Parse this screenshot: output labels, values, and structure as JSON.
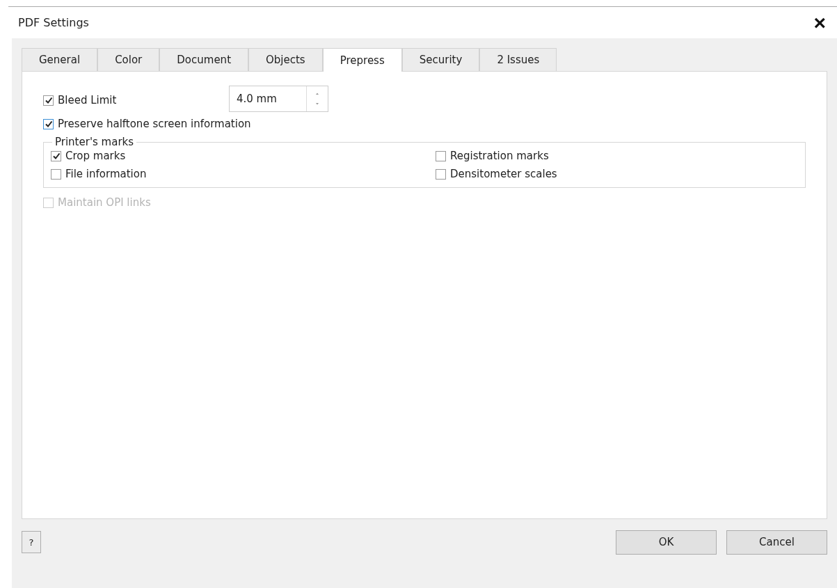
{
  "window": {
    "title": "PDF Settings",
    "close": "×"
  },
  "tabs": [
    {
      "label": "General",
      "selected": false
    },
    {
      "label": "Color",
      "selected": false
    },
    {
      "label": "Document",
      "selected": false
    },
    {
      "label": "Objects",
      "selected": false
    },
    {
      "label": "Prepress",
      "selected": true
    },
    {
      "label": "Security",
      "selected": false
    },
    {
      "label": "2 Issues",
      "selected": false
    }
  ],
  "bleed_limit": {
    "label": "Bleed Limit",
    "checked": true,
    "value": "4.0 mm"
  },
  "preserve_halftone": {
    "label": "Preserve halftone screen information",
    "checked": true,
    "focused": true
  },
  "printers_marks": {
    "title": "Printer's marks",
    "options": [
      {
        "label": "Crop marks",
        "checked": true
      },
      {
        "label": "Registration marks",
        "checked": false
      },
      {
        "label": "File information",
        "checked": false
      },
      {
        "label": "Densitometer scales",
        "checked": false
      }
    ]
  },
  "maintain_opi": {
    "label": "Maintain OPI links",
    "checked": false,
    "disabled": true
  },
  "buttons": {
    "help": "?",
    "ok": "OK",
    "cancel": "Cancel"
  }
}
